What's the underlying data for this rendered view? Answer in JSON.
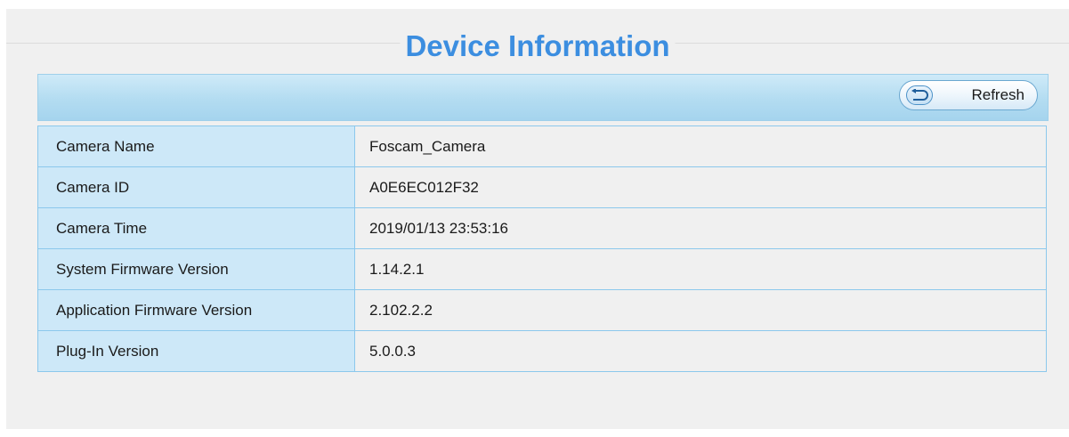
{
  "header": {
    "title": "Device Information"
  },
  "toolbar": {
    "refresh_label": "Refresh"
  },
  "info": {
    "rows": [
      {
        "label": "Camera Name",
        "value": "Foscam_Camera"
      },
      {
        "label": "Camera ID",
        "value": "A0E6EC012F32"
      },
      {
        "label": "Camera Time",
        "value": "2019/01/13 23:53:16"
      },
      {
        "label": "System Firmware Version",
        "value": "1.14.2.1"
      },
      {
        "label": "Application Firmware Version",
        "value": "2.102.2.2"
      },
      {
        "label": "Plug-In Version",
        "value": "5.0.0.3"
      }
    ]
  },
  "icons": {
    "refresh": "undo-arrow-icon"
  },
  "colors": {
    "title": "#3c8ee0",
    "toolbar": "#b3dcf1",
    "label_cell": "#cde8f8",
    "border": "#8cc8ec"
  }
}
